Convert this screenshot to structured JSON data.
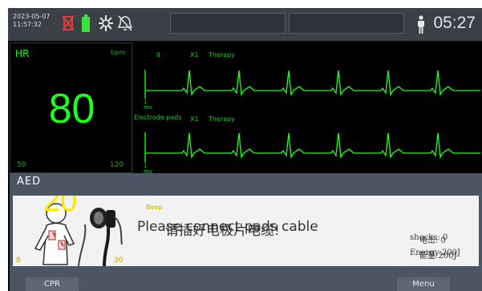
{
  "status_bar": {
    "date": "2023-05-07",
    "time": "11:57:32",
    "clock": "05:27",
    "icons": [
      "ecg-lead-off-icon",
      "battery-icon",
      "pacer-icon",
      "alarm-off-icon",
      "patient-icon"
    ]
  },
  "hr": {
    "label": "HR",
    "unit": "bpm",
    "value": "80",
    "low_limit": "50",
    "high_limit": "120"
  },
  "waves": [
    {
      "lead": "II",
      "gain": "X1",
      "filter": "Therapy",
      "scale_value": "1",
      "scale_unit": "mv"
    },
    {
      "lead": "Electrode pads",
      "gain": "X1",
      "filter": "Therapy",
      "scale_value": "1",
      "scale_unit": "mv"
    }
  ],
  "aed": {
    "title": "AED",
    "countdown": "20",
    "countdown_low": "8",
    "countdown_high": "30",
    "beep": "Beep",
    "prompt_en": "Please connect pads cable",
    "prompt_cn": "请插好电极片电缆!",
    "shocks_label": "shocks: 0",
    "shocks_cn": "电击: 0",
    "energy_label": "Energy:200J",
    "energy_cn": "能量:200J"
  },
  "softkeys": {
    "left": "CPR",
    "right": "Menu"
  },
  "colors": {
    "ecg_green": "#1dff1d",
    "countdown_yellow": "#ffe800",
    "panel_gray": "#4b5564"
  }
}
